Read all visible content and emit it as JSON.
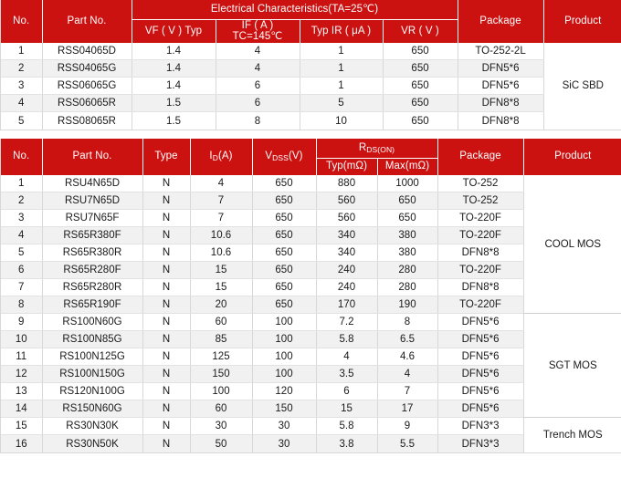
{
  "tables": [
    {
      "id": "sic-sbd-table",
      "header": {
        "no": "No.",
        "part_no": "Part No.",
        "group_title": "Electrical  Characteristics(TA=25℃)",
        "sub": [
          "VF ( V ) Typ",
          "IF ( A )",
          "TC=145℃",
          "Typ IR ( μA )",
          "VR ( V )"
        ],
        "package": "Package",
        "product": "Product"
      },
      "rows": [
        {
          "no": "1",
          "part_no": "RSS04065D",
          "vf": "1.4",
          "if": "4",
          "ir": "1",
          "vr": "650",
          "package": "TO-252-2L"
        },
        {
          "no": "2",
          "part_no": "RSS04065G",
          "vf": "1.4",
          "if": "4",
          "ir": "1",
          "vr": "650",
          "package": "DFN5*6"
        },
        {
          "no": "3",
          "part_no": "RSS06065G",
          "vf": "1.4",
          "if": "6",
          "ir": "1",
          "vr": "650",
          "package": "DFN5*6"
        },
        {
          "no": "4",
          "part_no": "RSS06065R",
          "vf": "1.5",
          "if": "6",
          "ir": "5",
          "vr": "650",
          "package": "DFN8*8"
        },
        {
          "no": "5",
          "part_no": "RSS08065R",
          "vf": "1.5",
          "if": "8",
          "ir": "10",
          "vr": "650",
          "package": "DFN8*8"
        }
      ],
      "products": [
        {
          "label": "SiC SBD",
          "span": 5
        }
      ]
    },
    {
      "id": "mosfet-table",
      "header": {
        "no": "No.",
        "part_no": "Part No.",
        "type": "Type",
        "id_a": "(A)",
        "id_sub": "D",
        "id_main": "I",
        "vdss_main": "V",
        "vdss_sub": "DSS",
        "vdss_unit": "(V)",
        "rds_main": "R",
        "rds_sub": "DS(ON)",
        "typ": "Typ(mΩ)",
        "max": "Max(mΩ)",
        "package": "Package",
        "product": "Product"
      },
      "rows": [
        {
          "no": "1",
          "part_no": "RSU4N65D",
          "type": "N",
          "id": "4",
          "vdss": "650",
          "typ": "880",
          "max": "1000",
          "package": "TO-252"
        },
        {
          "no": "2",
          "part_no": "RSU7N65D",
          "type": "N",
          "id": "7",
          "vdss": "650",
          "typ": "560",
          "max": "650",
          "package": "TO-252"
        },
        {
          "no": "3",
          "part_no": "RSU7N65F",
          "type": "N",
          "id": "7",
          "vdss": "650",
          "typ": "560",
          "max": "650",
          "package": "TO-220F"
        },
        {
          "no": "4",
          "part_no": "RS65R380F",
          "type": "N",
          "id": "10.6",
          "vdss": "650",
          "typ": "340",
          "max": "380",
          "package": "TO-220F"
        },
        {
          "no": "5",
          "part_no": "RS65R380R",
          "type": "N",
          "id": "10.6",
          "vdss": "650",
          "typ": "340",
          "max": "380",
          "package": "DFN8*8"
        },
        {
          "no": "6",
          "part_no": "RS65R280F",
          "type": "N",
          "id": "15",
          "vdss": "650",
          "typ": "240",
          "max": "280",
          "package": "TO-220F"
        },
        {
          "no": "7",
          "part_no": "RS65R280R",
          "type": "N",
          "id": "15",
          "vdss": "650",
          "typ": "240",
          "max": "280",
          "package": "DFN8*8"
        },
        {
          "no": "8",
          "part_no": "RS65R190F",
          "type": "N",
          "id": "20",
          "vdss": "650",
          "typ": "170",
          "max": "190",
          "package": "TO-220F"
        },
        {
          "no": "9",
          "part_no": "RS100N60G",
          "type": "N",
          "id": "60",
          "vdss": "100",
          "typ": "7.2",
          "max": "8",
          "package": "DFN5*6"
        },
        {
          "no": "10",
          "part_no": "RS100N85G",
          "type": "N",
          "id": "85",
          "vdss": "100",
          "typ": "5.8",
          "max": "6.5",
          "package": "DFN5*6"
        },
        {
          "no": "11",
          "part_no": "RS100N125G",
          "type": "N",
          "id": "125",
          "vdss": "100",
          "typ": "4",
          "max": "4.6",
          "package": "DFN5*6"
        },
        {
          "no": "12",
          "part_no": "RS100N150G",
          "type": "N",
          "id": "150",
          "vdss": "100",
          "typ": "3.5",
          "max": "4",
          "package": "DFN5*6"
        },
        {
          "no": "13",
          "part_no": "RS120N100G",
          "type": "N",
          "id": "100",
          "vdss": "120",
          "typ": "6",
          "max": "7",
          "package": "DFN5*6"
        },
        {
          "no": "14",
          "part_no": "RS150N60G",
          "type": "N",
          "id": "60",
          "vdss": "150",
          "typ": "15",
          "max": "17",
          "package": "DFN5*6"
        },
        {
          "no": "15",
          "part_no": "RS30N30K",
          "type": "N",
          "id": "30",
          "vdss": "30",
          "typ": "5.8",
          "max": "9",
          "package": "DFN3*3"
        },
        {
          "no": "16",
          "part_no": "RS30N50K",
          "type": "N",
          "id": "50",
          "vdss": "30",
          "typ": "3.8",
          "max": "5.5",
          "package": "DFN3*3"
        }
      ],
      "products": [
        {
          "label": "COOL MOS",
          "span": 8
        },
        {
          "label": "SGT MOS",
          "span": 6
        },
        {
          "label": "Trench MOS",
          "span": 2
        }
      ]
    }
  ],
  "colors": {
    "header_red": "#CC1111",
    "row_alt": "#f1f1f1",
    "grid": "#d8d8d8",
    "text": "#1a1a1a"
  }
}
